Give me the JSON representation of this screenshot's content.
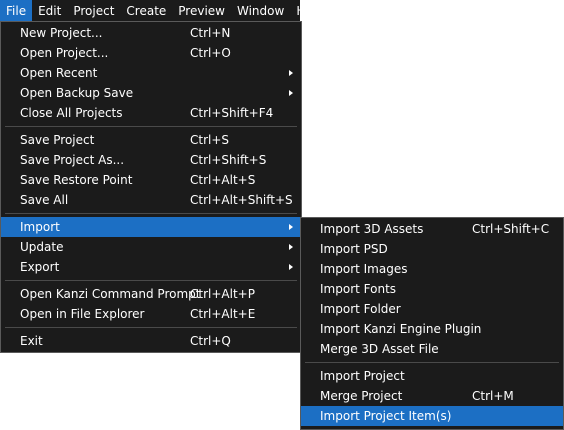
{
  "menubar": {
    "items": [
      "File",
      "Edit",
      "Project",
      "Create",
      "Preview",
      "Window",
      "Help"
    ]
  },
  "file_menu": {
    "group1": [
      {
        "label": "New Project...",
        "shortcut": "Ctrl+N"
      },
      {
        "label": "Open Project...",
        "shortcut": "Ctrl+O"
      },
      {
        "label": "Open Recent",
        "shortcut": ""
      },
      {
        "label": "Open Backup Save",
        "shortcut": ""
      },
      {
        "label": "Close All Projects",
        "shortcut": "Ctrl+Shift+F4"
      }
    ],
    "group2": [
      {
        "label": "Save Project",
        "shortcut": "Ctrl+S"
      },
      {
        "label": "Save Project As...",
        "shortcut": "Ctrl+Shift+S"
      },
      {
        "label": "Save Restore Point",
        "shortcut": "Ctrl+Alt+S"
      },
      {
        "label": "Save All",
        "shortcut": "Ctrl+Alt+Shift+S"
      }
    ],
    "group3": [
      {
        "label": "Import"
      },
      {
        "label": "Update"
      },
      {
        "label": "Export"
      }
    ],
    "group4": [
      {
        "label": "Open Kanzi Command Prompt",
        "shortcut": "Ctrl+Alt+P"
      },
      {
        "label": "Open in File Explorer",
        "shortcut": "Ctrl+Alt+E"
      }
    ],
    "group5": [
      {
        "label": "Exit",
        "shortcut": "Ctrl+Q"
      }
    ]
  },
  "import_submenu": {
    "group1": [
      {
        "label": "Import 3D Assets",
        "shortcut": "Ctrl+Shift+C"
      },
      {
        "label": "Import PSD",
        "shortcut": ""
      },
      {
        "label": "Import Images",
        "shortcut": ""
      },
      {
        "label": "Import Fonts",
        "shortcut": ""
      },
      {
        "label": "Import Folder",
        "shortcut": ""
      },
      {
        "label": "Import Kanzi Engine Plugin",
        "shortcut": ""
      },
      {
        "label": "Merge 3D Asset File",
        "shortcut": ""
      }
    ],
    "group2": [
      {
        "label": "Import Project",
        "shortcut": ""
      },
      {
        "label": "Merge Project",
        "shortcut": "Ctrl+M"
      },
      {
        "label": "Import Project Item(s)",
        "shortcut": ""
      }
    ]
  }
}
